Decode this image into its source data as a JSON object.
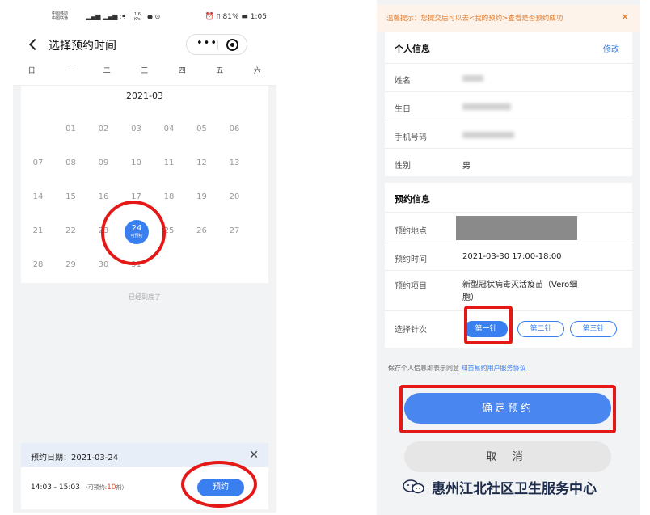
{
  "left_screen": {
    "status_bar": {
      "carrier1": "中国移动",
      "carrier2": "中国联通",
      "speed": "1.6 K/s",
      "battery": "81%",
      "time": "1:05"
    },
    "nav": {
      "title": "选择预约时间",
      "more_label": "•••"
    },
    "weekdays": [
      "日",
      "一",
      "二",
      "三",
      "四",
      "五",
      "六"
    ],
    "month": "2021-03",
    "weeks": [
      [
        "",
        "01",
        "02",
        "03",
        "04",
        "05",
        "06"
      ],
      [
        "07",
        "08",
        "09",
        "10",
        "11",
        "12",
        "13"
      ],
      [
        "14",
        "15",
        "16",
        "17",
        "18",
        "19",
        "20"
      ],
      [
        "21",
        "22",
        "23",
        "",
        "25",
        "26",
        "27"
      ],
      [
        "28",
        "29",
        "30",
        "31",
        "",
        "",
        ""
      ]
    ],
    "selected_day": {
      "day": "24",
      "sub": "可预约"
    },
    "end_tip": "已经到底了",
    "date_bar": {
      "label": "预约日期：2021-03-24",
      "close": "✕"
    },
    "slot": {
      "time": "14:03 - 15:03",
      "avail_prefix": "（可预约:",
      "count": "10",
      "avail_suffix": "剂）",
      "button": "预约"
    }
  },
  "right_screen": {
    "notice": {
      "text": "温馨提示：您提交后可以去<我的预约>查看是否预约成功",
      "close": "✕"
    },
    "personal": {
      "title": "个人信息",
      "edit": "修改",
      "name_label": "姓名",
      "birth_label": "生日",
      "phone_label": "手机号码",
      "gender_label": "性别",
      "gender_value": "男"
    },
    "booking": {
      "title": "预约信息",
      "place_label": "预约地点",
      "time_label": "预约时间",
      "time_value": "2021-03-30 17:00-18:00",
      "item_label": "预约项目",
      "item_value_line1": "新型冠状病毒灭活疫苗（Vero细",
      "item_value_line2": "胞）",
      "dose_label": "选择针次",
      "doses": [
        "第一针",
        "第二针",
        "第三针"
      ]
    },
    "agreement": {
      "prefix": "保存个人信息即表示同意",
      "link": "知苗易约用户服务协议"
    },
    "confirm": "确定预约",
    "cancel": "取 消"
  },
  "watermark": "惠州江北社区卫生服务中心",
  "colors": {
    "accent": "#3a7ff0",
    "annotation": "#e51818",
    "notice": "#e07a2c"
  }
}
